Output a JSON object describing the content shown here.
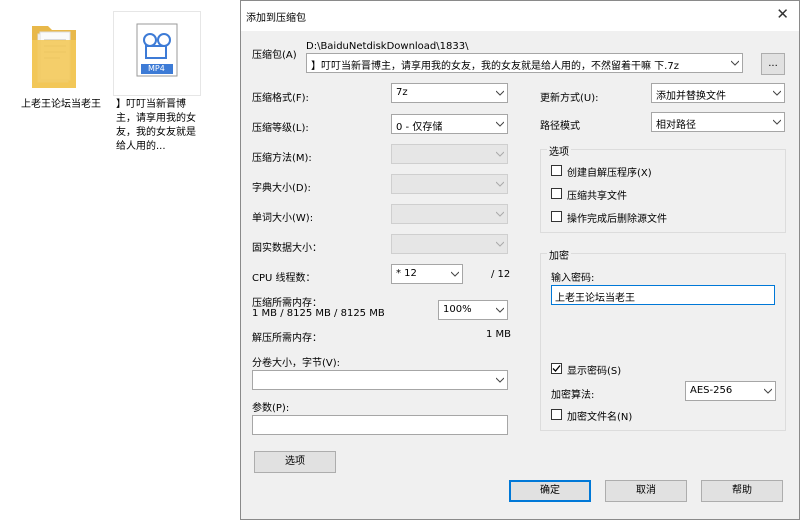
{
  "desktop": {
    "folder_label": "上老王论坛当老王",
    "video_label": "】叮叮当新晋博主，请享用我的女友，我的女友就是给人用的...",
    "video_badge": "MP4"
  },
  "dialog": {
    "title": "添加到压缩包",
    "archive": {
      "label": "压缩包(A)",
      "folder": "D:\\BaiduNetdiskDownload\\1833\\",
      "filename": "】叮叮当新晋博主，请享用我的女友，我的女友就是给人用的，不然留着干嘛 下.7z",
      "browse": "..."
    },
    "left": {
      "format_label": "压缩格式(F):",
      "format_value": "7z",
      "level_label": "压缩等级(L):",
      "level_value": "0 - 仅存储",
      "method_label": "压缩方法(M):",
      "dict_label": "字典大小(D):",
      "word_label": "单词大小(W):",
      "solid_label": "固实数据大小：",
      "cpu_label": "CPU 线程数：",
      "cpu_value": "* 12",
      "cpu_total": "/ 12",
      "mem_label": "压缩所需内存：",
      "mem_detail": "1 MB / 8125 MB / 8125 MB",
      "mem_percent": "100%",
      "decomp_label": "解压所需内存：",
      "decomp_value": "1 MB",
      "split_label": "分卷大小，字节(V):",
      "params_label": "参数(P):",
      "options_button": "选项"
    },
    "right": {
      "update_label": "更新方式(U):",
      "update_value": "添加并替换文件",
      "path_label": "路径模式",
      "path_value": "相对路径",
      "options_group": "选项",
      "opt_sfx": "创建自解压程序(X)",
      "opt_shared": "压缩共享文件",
      "opt_delete": "操作完成后删除源文件",
      "enc_group": "加密",
      "pwd_label": "输入密码:",
      "pwd_value": "上老王论坛当老王",
      "show_pwd": "显示密码(S)",
      "enc_method_label": "加密算法:",
      "enc_method_value": "AES-256",
      "enc_names": "加密文件名(N)"
    },
    "buttons": {
      "ok": "确定",
      "cancel": "取消",
      "help": "帮助"
    }
  }
}
